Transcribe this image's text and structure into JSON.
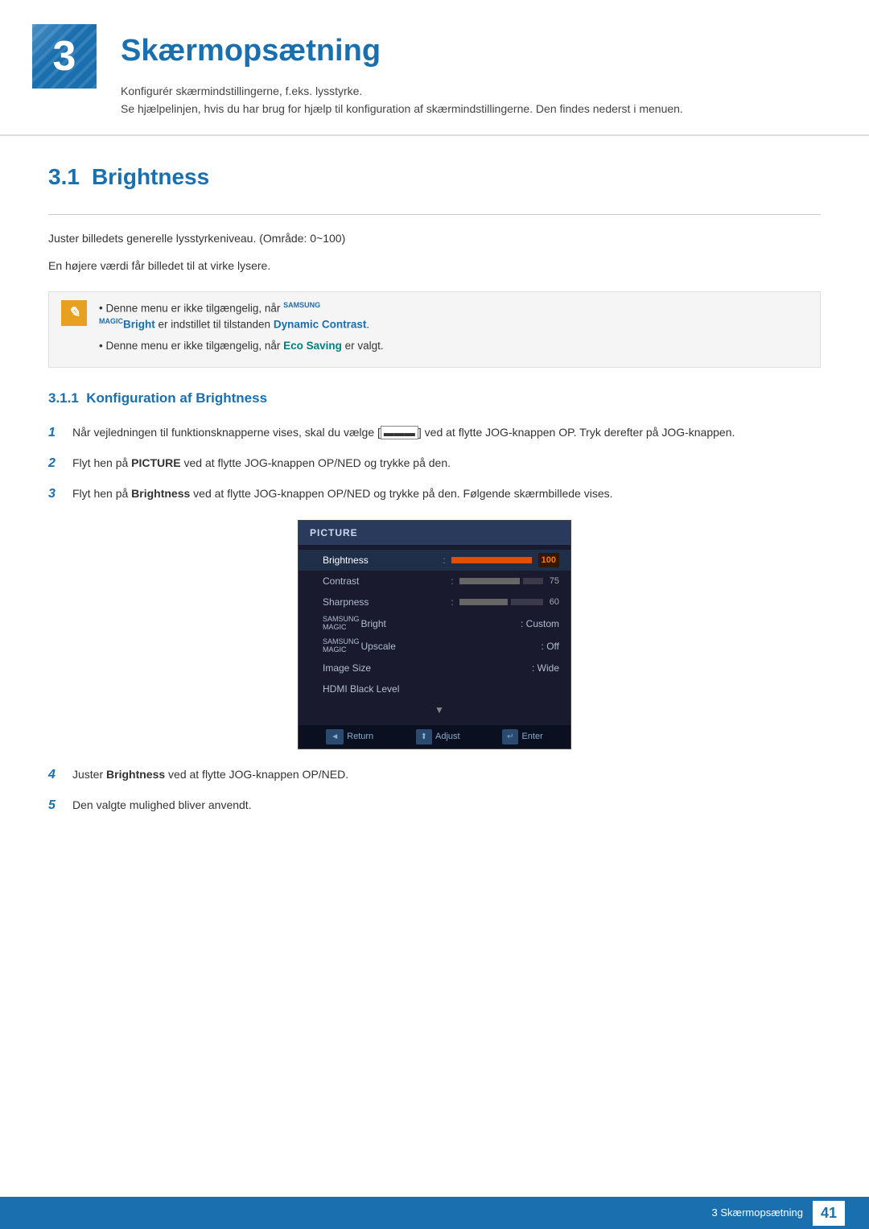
{
  "chapter": {
    "number": "3",
    "title": "Skærmopsætning",
    "desc_line1": "Konfigurér skærmindstillingerne, f.eks. lysstyrke.",
    "desc_line2": "Se hjælpelinjen, hvis du har brug for hjælp til konfiguration af skærmindstillingerne. Den findes nederst i menuen."
  },
  "section31": {
    "number": "3.1",
    "title": "Brightness",
    "body1": "Juster billedets generelle lysstyrkeniveau. (Område: 0~100)",
    "body2": "En højere værdi får billedet til at virke lysere.",
    "note1_prefix": "Denne menu er ikke tilgængelig, når ",
    "note1_brand": "SAMSUNG",
    "note1_magic": "MAGIC",
    "note1_bright": "Bright",
    "note1_suffix": " er indstillet til tilstanden ",
    "note1_contrast": "Dynamic Contrast",
    "note1_end": ".",
    "note2_prefix": "Denne menu er ikke tilgængelig, når ",
    "note2_eco": "Eco Saving",
    "note2_suffix": " er valgt."
  },
  "subsection311": {
    "number": "3.1.1",
    "title": "Konfiguration af Brightness"
  },
  "steps": [
    {
      "number": "1",
      "text_before": "Når vejledningen til funktionsknapperne vises, skal du vælge [",
      "icon": "☰",
      "text_after": "] ved at flytte JOG-knappen OP. Tryk derefter på JOG-knappen."
    },
    {
      "number": "2",
      "text_before": "Flyt hen på ",
      "bold": "PICTURE",
      "text_after": " ved at flytte JOG-knappen OP/NED og trykke på den."
    },
    {
      "number": "3",
      "text_before": "Flyt hen på ",
      "bold": "Brightness",
      "text_after": " ved at flytte JOG-knappen OP/NED og trykke på den. Følgende skærmbillede vises."
    },
    {
      "number": "4",
      "text_before": "Juster ",
      "bold": "Brightness",
      "text_after": " ved at flytte JOG-knappen OP/NED."
    },
    {
      "number": "5",
      "text": "Den valgte mulighed bliver anvendt."
    }
  ],
  "monitor_menu": {
    "title": "PICTURE",
    "items": [
      {
        "label": "Brightness",
        "bar_filled": 120,
        "bar_empty": 0,
        "value": "100",
        "active": true,
        "has_bar": true,
        "orange": true
      },
      {
        "label": "Contrast",
        "bar_filled": 90,
        "bar_empty": 30,
        "value": "75",
        "active": false,
        "has_bar": true,
        "orange": false
      },
      {
        "label": "Sharpness",
        "bar_filled": 72,
        "bar_empty": 48,
        "value": "60",
        "active": false,
        "has_bar": true,
        "orange": false
      },
      {
        "label": "SAMSUNG MAGIC Bright",
        "colon": ":",
        "value": "Custom",
        "active": false,
        "has_bar": false
      },
      {
        "label": "SAMSUNG MAGIC Upscale",
        "colon": ":",
        "value": "Off",
        "active": false,
        "has_bar": false
      },
      {
        "label": "Image Size",
        "colon": ":",
        "value": "Wide",
        "active": false,
        "has_bar": false
      },
      {
        "label": "HDMI Black Level",
        "colon": "",
        "value": "",
        "active": false,
        "has_bar": false
      },
      {
        "label": "▼",
        "colon": "",
        "value": "",
        "active": false,
        "has_bar": false
      }
    ],
    "footer": [
      {
        "icon": "◄",
        "label": "Return"
      },
      {
        "icon": "⬆",
        "label": "Adjust"
      },
      {
        "icon": "↵",
        "label": "Enter"
      }
    ]
  },
  "page_footer": {
    "text": "3 Skærmopsætning",
    "page_number": "41"
  }
}
